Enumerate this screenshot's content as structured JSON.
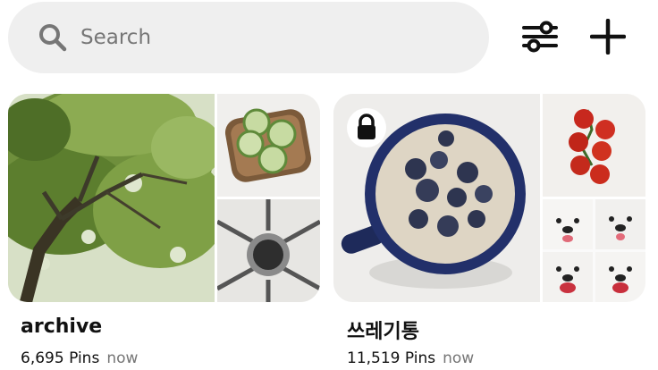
{
  "search": {
    "placeholder": "Search",
    "icon": "search-icon"
  },
  "toolbar": {
    "filter_icon": "filter-sliders-icon",
    "add_icon": "plus-icon"
  },
  "boards": [
    {
      "title": "archive",
      "pin_count": "6,695 Pins",
      "updated": "now",
      "private": false,
      "cover": [
        "tree-photo",
        "cucumber-toast-photo",
        "gas-burner-photo"
      ]
    },
    {
      "title": "쓰레기통",
      "pin_count": "11,519 Pins",
      "updated": "now",
      "private": true,
      "cover": [
        "blueberry-milk-mug-photo",
        "cherry-tomatoes-photo",
        "samoyed-dogs-collage-photo"
      ]
    }
  ],
  "colors": {
    "search_bg": "#efefef",
    "placeholder": "#767676",
    "text": "#111111"
  }
}
